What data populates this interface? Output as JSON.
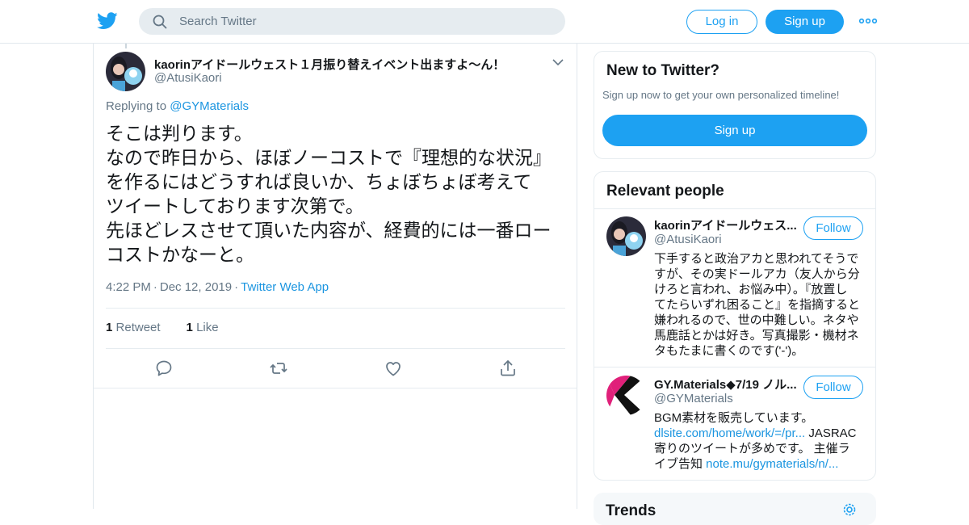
{
  "header": {
    "logo_icon": "twitter-bird-icon",
    "search_placeholder": "Search Twitter",
    "login_label": "Log in",
    "signup_label": "Sign up",
    "more_icon": "more-dots-icon",
    "accent_color": "#1da1f2"
  },
  "tweet": {
    "author_name": "kaorinアイドールウェスト１月振り替えイベント出ますよ～ん！",
    "author_handle": "@AtusiKaori",
    "replying_prefix": "Replying to",
    "replying_to": "@GYMaterials",
    "text_lines": [
      "そこは判ります。",
      "なので昨日から、ほぼノーコストで『理想的な状況』",
      "を作るにはどうすれば良いか、ちょぼちょぼ考えて",
      "ツイートしております次第で。",
      "先ほどレスさせて頂いた内容が、経費的には一番ロー",
      "コストかなーと。"
    ],
    "time": "4:22 PM",
    "date": "Dec 12, 2019",
    "source": "Twitter Web App",
    "retweet_count": "1",
    "retweet_label": "Retweet",
    "like_count": "1",
    "like_label": "Like",
    "actions": [
      "reply-icon",
      "retweet-icon",
      "like-icon",
      "share-icon"
    ]
  },
  "sidebar": {
    "new_to_twitter": {
      "title": "New to Twitter?",
      "subtitle": "Sign up now to get your own personalized timeline!",
      "button": "Sign up"
    },
    "relevant_people": {
      "title": "Relevant people",
      "people": [
        {
          "name": "kaorinアイドールウェス...",
          "handle": "@AtusiKaori",
          "follow": "Follow",
          "bio_lines": [
            "下手すると政治アカと思われてそうで",
            "すが、その実ドールアカ（友人から分",
            "けろと言われ、お悩み中）。『放置し",
            "てたらいずれ困ること』を指摘すると",
            "嫌われるので、世の中難しい。ネタや",
            "馬鹿話とかは好き。写真撮影・機材ネ",
            "タもたまに書くのです('-')。"
          ]
        },
        {
          "name": "GY.Materials◆7/19 ノル...",
          "handle": "@GYMaterials",
          "follow": "Follow",
          "bio_line1": "BGM素材を販売しています。",
          "bio_link1": "dlsite.com/home/work/=/pr...",
          "bio_line2_suffix": " JASRAC",
          "bio_line3": "寄りのツイートが多めです。 主催ラ",
          "bio_line4_prefix": "イブ告知 ",
          "bio_link2": "note.mu/gymaterials/n/..."
        }
      ]
    },
    "trends": {
      "title": "Trends",
      "settings_icon": "gear-icon"
    }
  }
}
